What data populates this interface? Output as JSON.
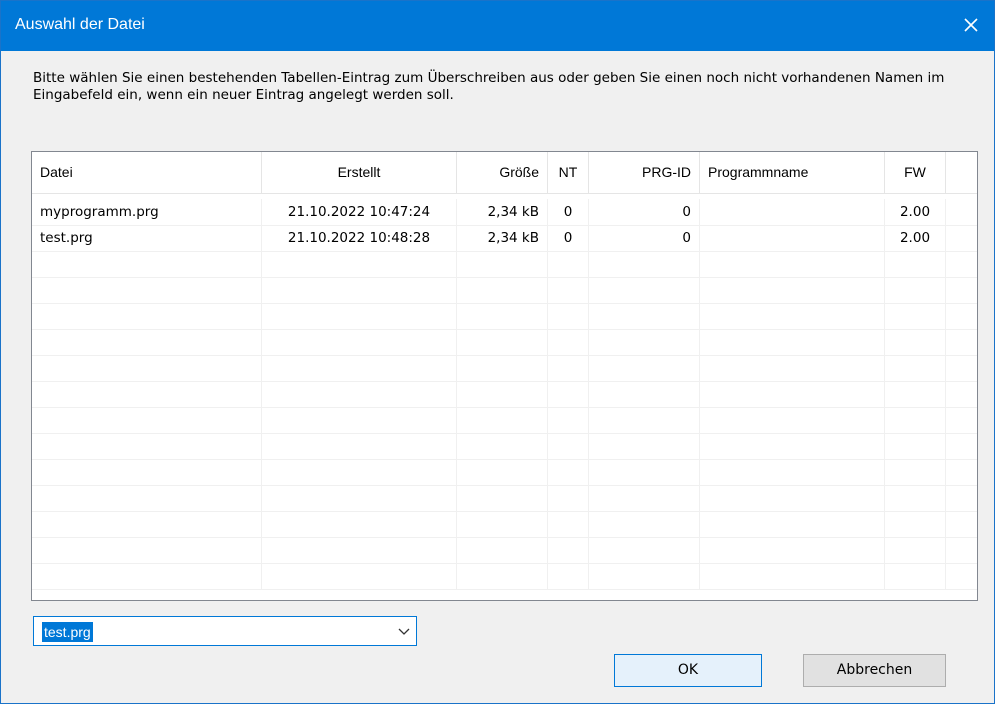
{
  "window": {
    "title": "Auswahl der Datei",
    "close_glyph": "close-icon"
  },
  "instructions": "Bitte wählen Sie einen bestehenden Tabellen-Eintrag zum Überschreiben aus oder geben Sie einen noch nicht vorhandenen Namen im Eingabefeld ein, wenn ein neuer Eintrag angelegt werden soll.",
  "table": {
    "columns": [
      "Datei",
      "Erstellt",
      "Größe",
      "NT",
      "PRG-ID",
      "Programmname",
      "FW"
    ],
    "rows": [
      [
        "myprogramm.prg",
        "21.10.2022 10:47:24",
        "2,34 kB",
        "0",
        "0",
        "",
        "2.00"
      ],
      [
        "test.prg",
        "21.10.2022 10:48:28",
        "2,34 kB",
        "0",
        "0",
        "",
        "2.00"
      ]
    ]
  },
  "combo": {
    "value": "test.prg"
  },
  "buttons": {
    "ok": "OK",
    "cancel": "Abbrechen"
  },
  "colors": {
    "accent": "#0078d7",
    "ok_bg": "#e5f1fb",
    "cancel_bg": "#e1e1e1"
  }
}
